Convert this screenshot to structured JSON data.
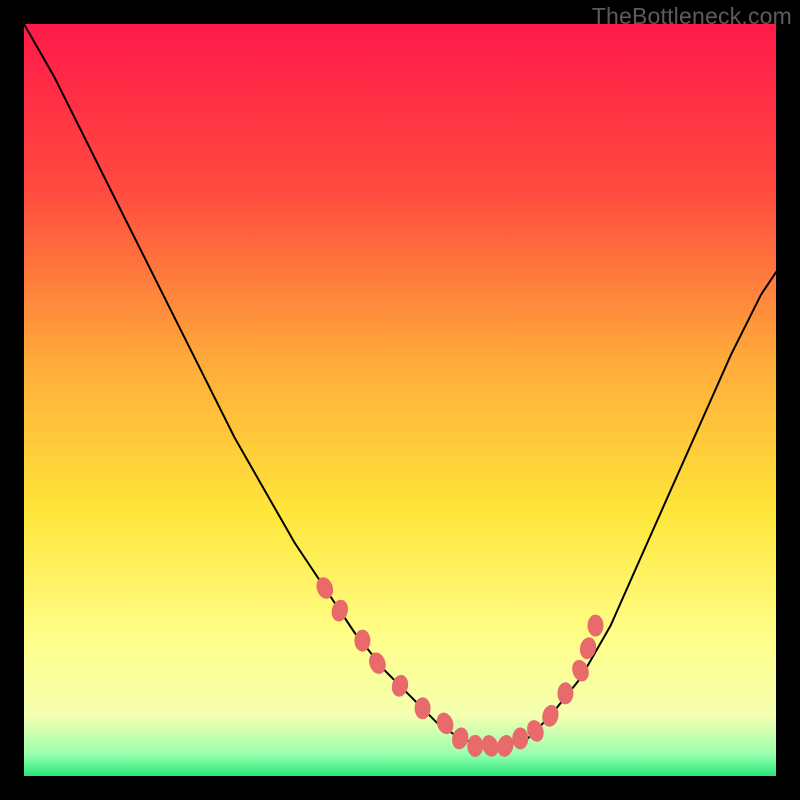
{
  "watermark": "TheBottleneck.com",
  "chart_data": {
    "type": "line",
    "title": "",
    "xlabel": "",
    "ylabel": "",
    "xlim": [
      0,
      100
    ],
    "ylim": [
      0,
      100
    ],
    "background_gradient": {
      "top": "#ff1a4a",
      "mid_upper": "#ff7e3a",
      "mid": "#ffe63a",
      "mid_lower": "#ffff8a",
      "bottom": "#2aff80"
    },
    "series": [
      {
        "name": "bottleneck-curve",
        "type": "line",
        "color": "#000000",
        "x": [
          0,
          4,
          8,
          12,
          16,
          20,
          24,
          28,
          32,
          36,
          40,
          44,
          48,
          52,
          55,
          58,
          61,
          64,
          67,
          70,
          74,
          78,
          82,
          86,
          90,
          94,
          98,
          100
        ],
        "y": [
          100,
          93,
          85,
          77,
          69,
          61,
          53,
          45,
          38,
          31,
          25,
          19,
          14,
          10,
          7,
          5,
          4,
          4,
          5,
          8,
          13,
          20,
          29,
          38,
          47,
          56,
          64,
          67
        ]
      },
      {
        "name": "highlight-dots",
        "type": "scatter",
        "color": "#e86a6a",
        "x": [
          40,
          42,
          45,
          47,
          50,
          53,
          56,
          58,
          60,
          62,
          64,
          66,
          68,
          70,
          72,
          74,
          75,
          76
        ],
        "y": [
          25,
          22,
          18,
          15,
          12,
          9,
          7,
          5,
          4,
          4,
          4,
          5,
          6,
          8,
          11,
          14,
          17,
          20
        ]
      }
    ]
  }
}
